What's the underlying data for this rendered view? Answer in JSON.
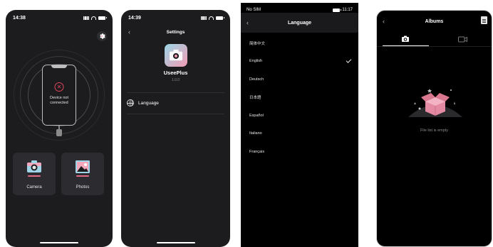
{
  "screen1": {
    "time": "14:38",
    "device_status_line1": "Device not",
    "device_status_line2": "connected",
    "tiles": [
      {
        "label": "Camera"
      },
      {
        "label": "Photos"
      }
    ]
  },
  "screen2": {
    "time": "14:39",
    "title": "Settings",
    "app_name": "UseePlus",
    "app_version": "1.0.0",
    "language_label": "Language"
  },
  "screen3": {
    "status_left": "No SIM",
    "time": "11:17",
    "title": "Language",
    "languages": [
      "简体中文",
      "English",
      "Deutsch",
      "日本語",
      "Español",
      "Italiano",
      "Français"
    ],
    "selected_index": 1
  },
  "screen4": {
    "title": "Albums",
    "tabs": [
      {
        "icon": "camera-icon",
        "active": true
      },
      {
        "icon": "video-icon",
        "active": false
      }
    ],
    "empty_text": "File list is empty"
  },
  "colors": {
    "accent_pink": "#e46b86",
    "error_red": "#e0455b",
    "dark_bg": "#1c1c1e",
    "tile_bg": "#2c2c30"
  }
}
